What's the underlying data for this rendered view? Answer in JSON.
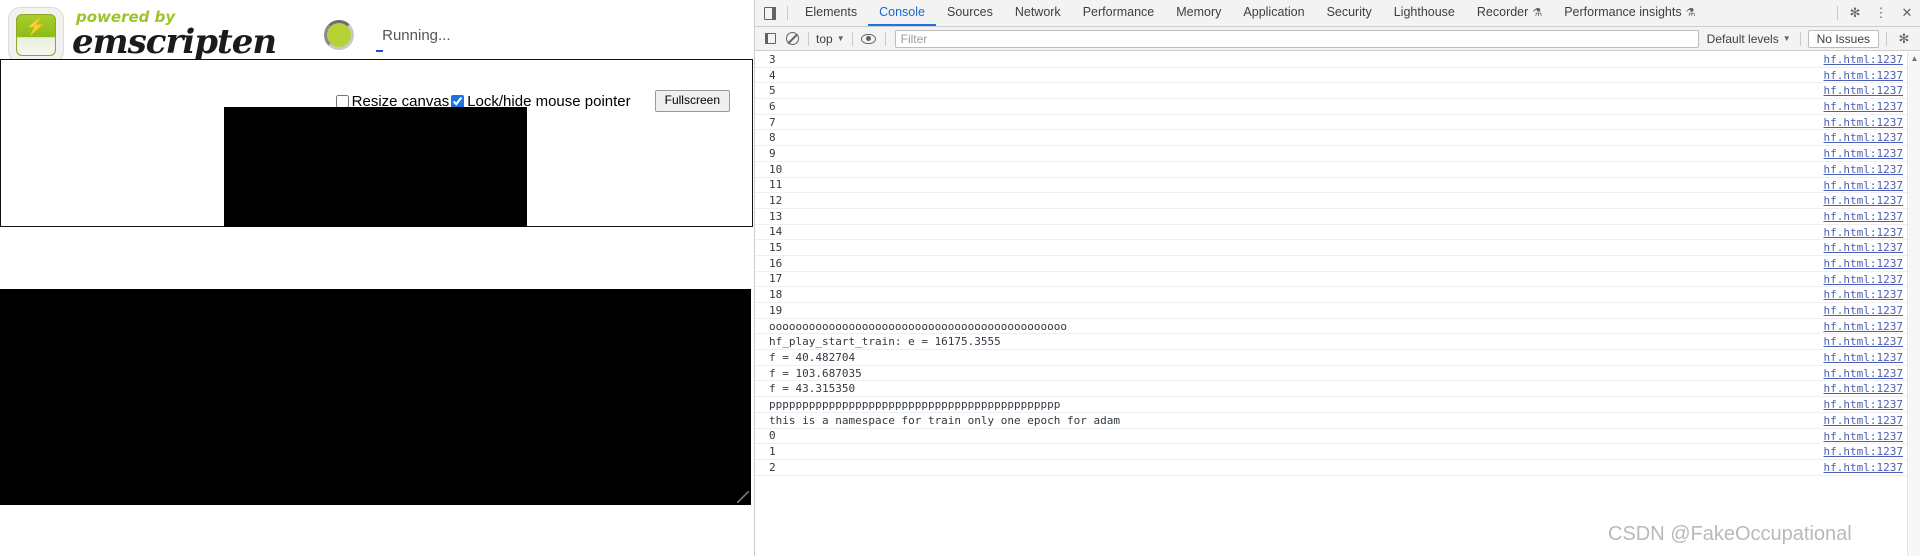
{
  "page": {
    "banner": {
      "powered_by": "powered by",
      "product": "emscripten",
      "logo_bolt": "⚡",
      "status": "Running..."
    },
    "controls": {
      "resize_canvas_label": "Resize canvas",
      "resize_canvas_checked": false,
      "lock_pointer_label": "Lock/hide mouse pointer",
      "lock_pointer_checked": true,
      "fullscreen_label": "Fullscreen",
      "checkbox_accent": "#1a73e8"
    },
    "canvas": {
      "background": "#000000"
    },
    "output_area": {
      "background": "#000000",
      "value": ""
    }
  },
  "devtools": {
    "tabs": [
      {
        "label": "Elements",
        "active": false,
        "flask": false
      },
      {
        "label": "Console",
        "active": true,
        "flask": false
      },
      {
        "label": "Sources",
        "active": false,
        "flask": false
      },
      {
        "label": "Network",
        "active": false,
        "flask": false
      },
      {
        "label": "Performance",
        "active": false,
        "flask": false
      },
      {
        "label": "Memory",
        "active": false,
        "flask": false
      },
      {
        "label": "Application",
        "active": false,
        "flask": false
      },
      {
        "label": "Security",
        "active": false,
        "flask": false
      },
      {
        "label": "Lighthouse",
        "active": false,
        "flask": false
      },
      {
        "label": "Recorder",
        "active": false,
        "flask": true
      },
      {
        "label": "Performance insights",
        "active": false,
        "flask": true
      }
    ],
    "tab_icons": {
      "dock": "dock-icon",
      "settings": "gear-icon",
      "more": "kebab-menu-icon",
      "close": "close-icon",
      "flask": "flask-icon",
      "gear_glyph": "✻",
      "kebab_glyph": "⋮",
      "close_glyph": "✕",
      "flask_glyph": "⚗"
    },
    "console_toolbar": {
      "sidebar_icon": "console-sidebar-icon",
      "clear_icon": "clear-console-icon",
      "context_value": "top",
      "eye_icon": "live-expression-icon",
      "filter_placeholder": "Filter",
      "filter_value": "",
      "levels_label": "Default levels",
      "issues_label": "No Issues",
      "settings_icon": "gear-icon",
      "gear_glyph": "✻",
      "caret_glyph": "▼"
    },
    "active_tab_accent": "#1a73e8",
    "source_link": "hf.html:1237",
    "scroll_up_glyph": "▲",
    "log_rows": [
      {
        "msg": "3",
        "src": "hf.html:1237"
      },
      {
        "msg": "4",
        "src": "hf.html:1237"
      },
      {
        "msg": "5",
        "src": "hf.html:1237"
      },
      {
        "msg": "6",
        "src": "hf.html:1237"
      },
      {
        "msg": "7",
        "src": "hf.html:1237"
      },
      {
        "msg": "8",
        "src": "hf.html:1237"
      },
      {
        "msg": "9",
        "src": "hf.html:1237"
      },
      {
        "msg": "10",
        "src": "hf.html:1237"
      },
      {
        "msg": "11",
        "src": "hf.html:1237"
      },
      {
        "msg": "12",
        "src": "hf.html:1237"
      },
      {
        "msg": "13",
        "src": "hf.html:1237"
      },
      {
        "msg": "14",
        "src": "hf.html:1237"
      },
      {
        "msg": "15",
        "src": "hf.html:1237"
      },
      {
        "msg": "16",
        "src": "hf.html:1237"
      },
      {
        "msg": "17",
        "src": "hf.html:1237"
      },
      {
        "msg": "18",
        "src": "hf.html:1237"
      },
      {
        "msg": "19",
        "src": "hf.html:1237"
      },
      {
        "msg": "ooooooooooooooooooooooooooooooooooooooooooooo",
        "src": "hf.html:1237"
      },
      {
        "msg": "hf_play_start_train: e = 16175.3555",
        "src": "hf.html:1237"
      },
      {
        "msg": "f = 40.482704",
        "src": "hf.html:1237"
      },
      {
        "msg": "f = 103.687035",
        "src": "hf.html:1237"
      },
      {
        "msg": "f = 43.315350",
        "src": "hf.html:1237"
      },
      {
        "msg": "pppppppppppppppppppppppppppppppppppppppppppp",
        "src": "hf.html:1237"
      },
      {
        "msg": "this is a namespace for train only one epoch for adam",
        "src": "hf.html:1237"
      },
      {
        "msg": "0",
        "src": "hf.html:1237"
      },
      {
        "msg": "1",
        "src": "hf.html:1237"
      },
      {
        "msg": "2",
        "src": "hf.html:1237"
      }
    ]
  },
  "watermark": {
    "text": "CSDN @FakeOccupational"
  }
}
